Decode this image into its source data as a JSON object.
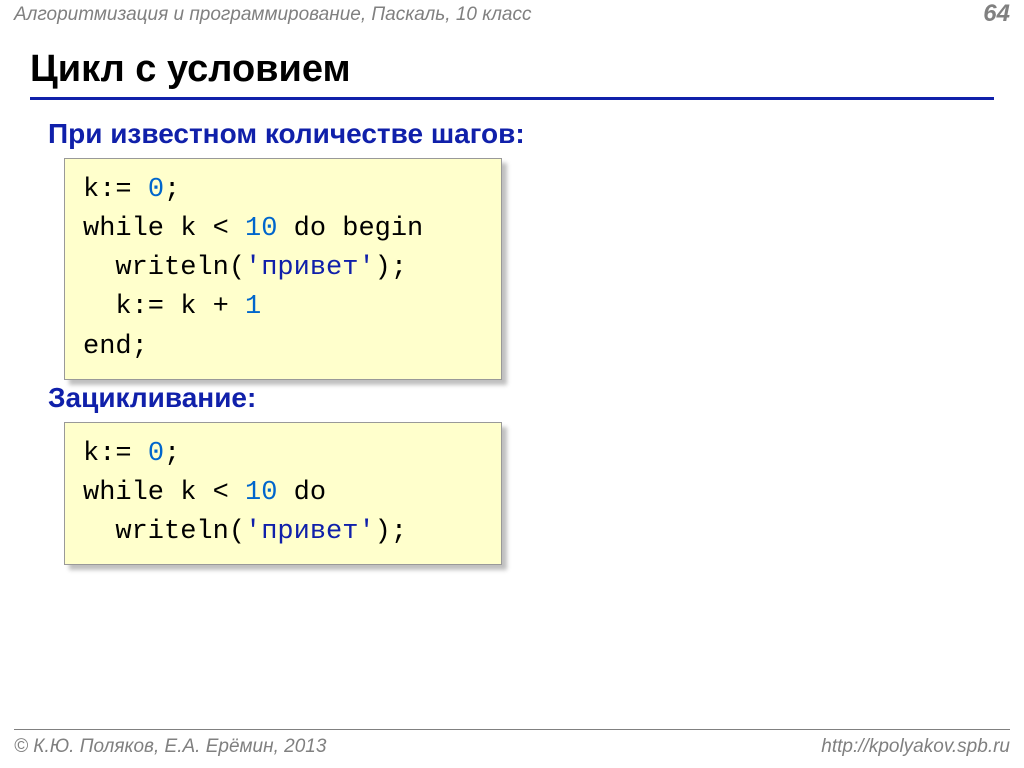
{
  "header": {
    "subject": "Алгоритмизация и программирование, Паскаль, 10 класс",
    "page_number": "64"
  },
  "title": "Цикл с условием",
  "sections": {
    "known_steps_heading": "При известном количестве шагов:",
    "infinite_heading": "Зацикливание:"
  },
  "code1": {
    "l1a": "k:= ",
    "l1n": "0",
    "l1b": ";",
    "l2a": "while k < ",
    "l2n": "10",
    "l2b": " do begin",
    "l3a": "  writeln(",
    "l3s": "'привет'",
    "l3b": ");",
    "l4a": "  k:= k + ",
    "l4n": "1",
    "l5a": "end;"
  },
  "code2": {
    "l1a": "k:= ",
    "l1n": "0",
    "l1b": ";",
    "l2a": "while k < ",
    "l2n": "10",
    "l2b": " do",
    "l3a": "  writeln(",
    "l3s": "'привет'",
    "l3b": ");"
  },
  "footer": {
    "authors": "© К.Ю. Поляков, Е.А. Ерёмин, 2013",
    "url": "http://kpolyakov.spb.ru"
  }
}
